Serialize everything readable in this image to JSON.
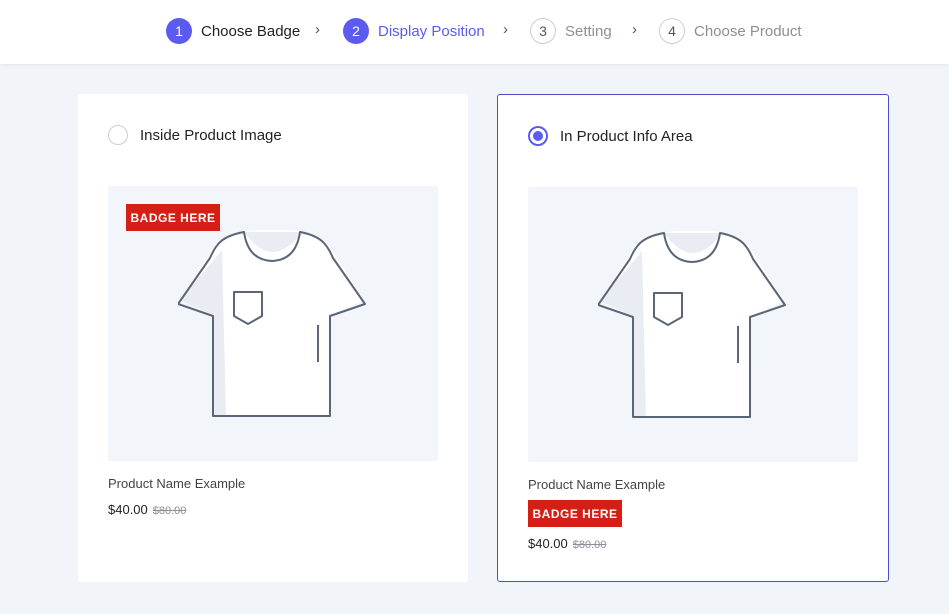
{
  "steps": [
    {
      "num": "1",
      "label": "Choose Badge"
    },
    {
      "num": "2",
      "label": "Display Position"
    },
    {
      "num": "3",
      "label": "Setting"
    },
    {
      "num": "4",
      "label": "Choose Product"
    }
  ],
  "chevron": "›",
  "options": [
    {
      "label": "Inside Product Image",
      "selected": false,
      "badge": "BADGE HERE",
      "product_name": "Product Name Example",
      "price": "$40.00",
      "old_price": "$80.00"
    },
    {
      "label": "In Product Info Area",
      "selected": true,
      "badge": "BADGE HERE",
      "product_name": "Product Name Example",
      "price": "$40.00",
      "old_price": "$80.00"
    }
  ],
  "colors": {
    "accent": "#5b5bf0",
    "badge": "#d41f16",
    "background": "#f1f4f8",
    "selected_border": "#4a4fc9"
  },
  "icons": {
    "product_image": "tshirt-icon",
    "step_separator": "chevron-right-icon"
  }
}
